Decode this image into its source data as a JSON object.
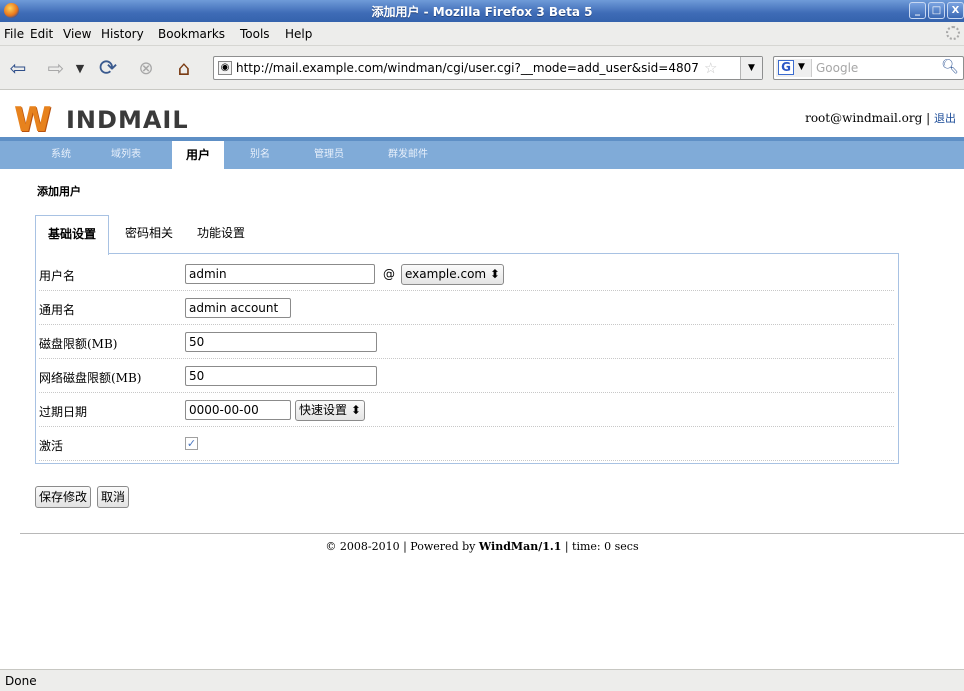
{
  "window": {
    "title": "添加用户 - Mozilla Firefox 3 Beta 5",
    "buttons": [
      "_",
      "□",
      "X"
    ]
  },
  "menubar": {
    "file": "File",
    "edit": "Edit",
    "view": "View",
    "history": "History",
    "bookmarks": "Bookmarks",
    "tools": "Tools",
    "help": "Help"
  },
  "toolbar": {
    "url": "http://mail.example.com/windman/cgi/user.cgi?__mode=add_user&sid=4807",
    "search_placeholder": "Google",
    "search_engine": "G",
    "icons": [
      "back-icon",
      "forward-icon",
      "history-dropdown-icon",
      "reload-icon",
      "stop-icon",
      "home-icon",
      "star-icon",
      "search-icon"
    ]
  },
  "header": {
    "logo_initial": "W",
    "logo_rest": "INDMAIL",
    "account": "root@windmail.org",
    "separator": "|",
    "logout": "退出"
  },
  "nav": {
    "tabs": [
      "系统",
      "域列表",
      "用户",
      "别名",
      "管理员",
      "群发邮件"
    ],
    "active": "用户"
  },
  "page": {
    "title": "添加用户"
  },
  "subtabs": [
    "基础设置",
    "密码相关",
    "功能设置"
  ],
  "form": {
    "username_label": "用户名",
    "username_value": "admin",
    "at": "@",
    "domain_select": "example.com",
    "common_name_label": "通用名",
    "common_name_value": "admin account",
    "disk_quota_label": "磁盘限额(MB)",
    "disk_quota_value": "50",
    "net_disk_quota_label": "网络磁盘限额(MB)",
    "net_disk_quota_value": "50",
    "expire_label": "过期日期",
    "expire_value": "0000-00-00",
    "quick_set": "快速设置",
    "active_label": "激活",
    "active_checked": true
  },
  "actions": {
    "save": "保存修改",
    "cancel": "取消"
  },
  "footer": {
    "copyright": "© 2008-2010 | Powered by",
    "product": "WindMan/1.1",
    "time": "| time: 0 secs"
  },
  "status": {
    "text": "Done"
  }
}
